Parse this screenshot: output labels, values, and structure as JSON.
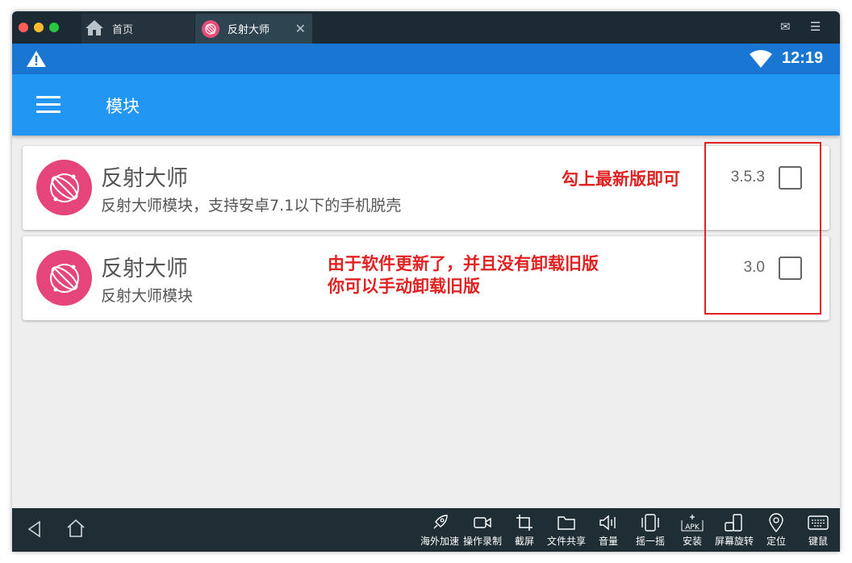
{
  "window": {
    "tabs": [
      {
        "label": "首页"
      },
      {
        "label": "反射大师"
      }
    ],
    "tab_close": "✕",
    "mail_icon": "✉",
    "menu_icon": "☰"
  },
  "statusbar": {
    "time": "12:19"
  },
  "appbar": {
    "title": "模块"
  },
  "modules": [
    {
      "name": "反射大师",
      "description": "反射大师模块，支持安卓7.1以下的手机脱壳",
      "version": "3.5.3",
      "checked": false
    },
    {
      "name": "反射大师",
      "description": "反射大师模块",
      "version": "3.0",
      "checked": false
    }
  ],
  "annotations": {
    "note1": "勾上最新版即可",
    "note2_line1": "由于软件更新了，并且没有卸载旧版",
    "note2_line2": "你可以手动卸载旧版"
  },
  "toolbar": [
    {
      "label": "海外加速",
      "icon": "rocket-icon"
    },
    {
      "label": "操作录制",
      "icon": "video-icon"
    },
    {
      "label": "截屏",
      "icon": "crop-icon"
    },
    {
      "label": "文件共享",
      "icon": "folder-icon"
    },
    {
      "label": "音量",
      "icon": "volume-icon"
    },
    {
      "label": "摇一摇",
      "icon": "shake-icon"
    },
    {
      "label": "安装",
      "icon": "apk-icon"
    },
    {
      "label": "屏幕旋转",
      "icon": "rotate-icon"
    },
    {
      "label": "定位",
      "icon": "location-icon"
    },
    {
      "label": "键鼠",
      "icon": "keyboard-icon"
    }
  ],
  "colors": {
    "appbar": "#2196f3",
    "statusbar": "#1976d2",
    "app_icon": "#e5457a",
    "annotation": "#e02222"
  }
}
